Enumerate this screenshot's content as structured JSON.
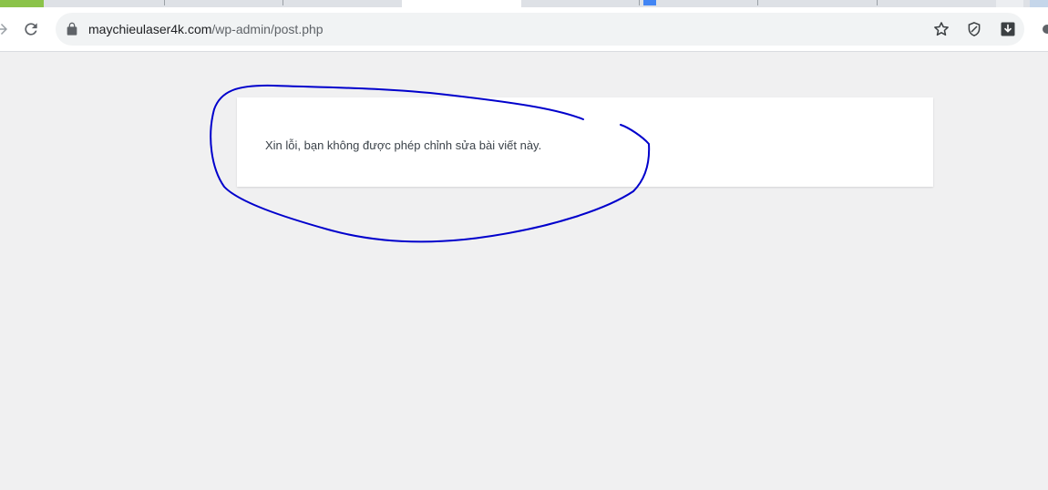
{
  "browser": {
    "address_bar": {
      "domain": "maychieulaser4k.com",
      "path": "/wp-admin/post.php"
    },
    "tab_colors": {
      "first_tab_accent": "#8bc34a",
      "active_tab": "#ffffff"
    },
    "icons": [
      "arrow-forward-icon",
      "reload-icon",
      "lock-icon",
      "bookmark-star-icon",
      "shield-extension-icon",
      "download-extension-icon"
    ]
  },
  "page": {
    "notice_message": "Xin lỗi, bạn không được phép chỉnh sửa bài viết này.",
    "annotation_color": "#0000cc"
  }
}
